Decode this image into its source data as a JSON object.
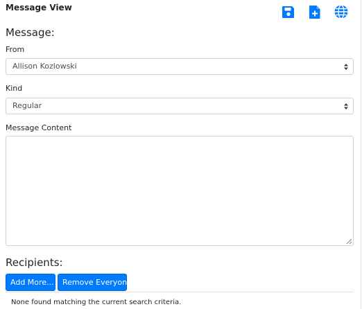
{
  "header": {
    "title": "Message View",
    "icons": [
      "save-icon",
      "file-add-icon",
      "globe-icon"
    ],
    "accent_color": "#007bff"
  },
  "message": {
    "section_title": "Message:",
    "from_label": "From",
    "from_value": "Allison Kozlowski",
    "kind_label": "Kind",
    "kind_value": "Regular",
    "content_label": "Message Content",
    "content_value": ""
  },
  "recipients": {
    "section_title": "Recipients:",
    "add_more_label": "Add More...",
    "remove_everyone_label": "Remove Everyone",
    "empty_text": "None found matching the current search criteria."
  }
}
